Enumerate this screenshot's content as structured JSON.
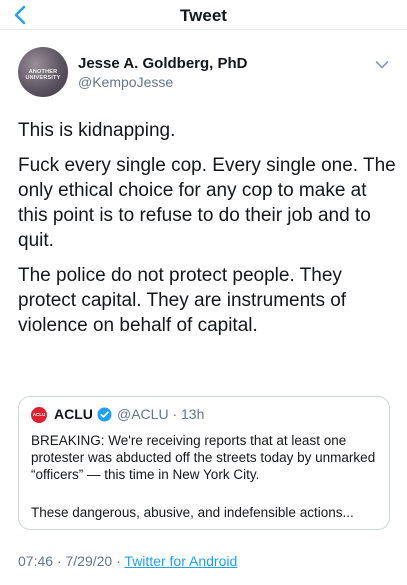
{
  "nav": {
    "title": "Tweet",
    "back_icon": "chevron-left-icon",
    "accent_color": "#1da1f2"
  },
  "author": {
    "display_name": "Jesse A. Goldberg, PhD",
    "handle": "@KempoJesse",
    "avatar_text": "ANOTHER UNIVERSITY",
    "menu_icon": "chevron-down-icon"
  },
  "tweet": {
    "paragraphs": [
      "This is kidnapping.",
      "Fuck every single cop. Every single one. The only ethical choice for any cop to make at this point is to refuse to do their job and to quit.",
      "The police do not protect people. They protect capital. They are instruments of violence on behalf of capital."
    ]
  },
  "quote": {
    "logo_text": "ACLU",
    "name": "ACLU",
    "verified_icon": "verified-badge-icon",
    "handle": "@ACLU",
    "separator": "·",
    "time": "13h",
    "text": "BREAKING: We're receiving reports that at least one protester was abducted off the streets today by unmarked “officers” — this time in New York City.",
    "truncated_text": "These dangerous, abusive, and indefensible actions..."
  },
  "meta": {
    "time": "07:46",
    "date": "7/29/20",
    "separator": "·",
    "source": "Twitter for Android"
  }
}
